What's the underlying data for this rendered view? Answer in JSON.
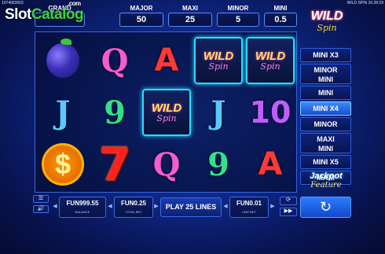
{
  "header": {
    "session_id": "1074063053",
    "status": "WILD SPIN 16:28:29"
  },
  "watermark": {
    "part1": "Slot",
    "part2": "Catalog",
    "part3": ".com"
  },
  "jackpots": [
    {
      "label": "GRAND",
      "value": ""
    },
    {
      "label": "MAJOR",
      "value": "50"
    },
    {
      "label": "MAXI",
      "value": "25"
    },
    {
      "label": "MINOR",
      "value": "5"
    },
    {
      "label": "MINI",
      "value": "0.5"
    }
  ],
  "logo": {
    "title": "WILD",
    "subtitle": "Spin"
  },
  "reels": [
    [
      "plum",
      "J",
      "$"
    ],
    [
      "Q",
      "9",
      "7"
    ],
    [
      "A",
      "WILD",
      "Q"
    ],
    [
      "WILD",
      "J",
      "9"
    ],
    [
      "WILD",
      "10",
      "A"
    ]
  ],
  "side_prizes": [
    "MINI X3",
    "MINOR\nMINI",
    "MINI",
    "MINI X4",
    "MINOR",
    "MAXI\nMINI",
    "MINI X5",
    "MAXI"
  ],
  "feature_label": {
    "line1": "Jackpot",
    "line2": "Feature"
  },
  "controls": {
    "menu_icon": "hamburger-icon",
    "sound_icon": "speaker-icon",
    "balance_value": "FUN999.55",
    "balance_caption": "BALANCE",
    "total_bet_value": "FUN0.25",
    "total_bet_caption": "TOTAL BET",
    "play_label": "PLAY 25 LINES",
    "line_bet_value": "FUN0.01",
    "line_bet_caption": "LINE BET",
    "autoplay_icon": "autoplay-icon",
    "fast_icon": "fast-forward-icon",
    "spin_icon": "spin-arrow-icon"
  }
}
